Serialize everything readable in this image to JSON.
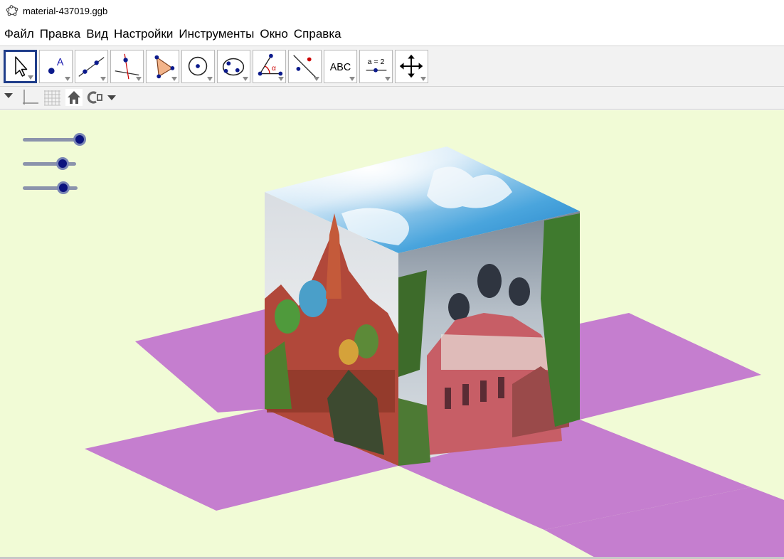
{
  "window": {
    "title": "material-437019.ggb"
  },
  "menu": {
    "items": [
      "Файл",
      "Правка",
      "Вид",
      "Настройки",
      "Инструменты",
      "Окно",
      "Справка"
    ]
  },
  "toolbar": {
    "tools": [
      {
        "name": "move-tool",
        "icon": "arrow-cursor-icon",
        "active": true
      },
      {
        "name": "point-tool",
        "icon": "point-icon",
        "label": "A"
      },
      {
        "name": "line-tool",
        "icon": "line-icon"
      },
      {
        "name": "perpendicular-tool",
        "icon": "perpendicular-line-icon"
      },
      {
        "name": "polygon-tool",
        "icon": "polygon-icon"
      },
      {
        "name": "circle-tool",
        "icon": "circle-icon"
      },
      {
        "name": "conic-tool",
        "icon": "ellipse-icon"
      },
      {
        "name": "angle-tool",
        "icon": "angle-icon",
        "label": "α"
      },
      {
        "name": "reflect-tool",
        "icon": "reflect-icon"
      },
      {
        "name": "text-tool",
        "icon": "text-icon",
        "label": "ABC"
      },
      {
        "name": "slider-tool",
        "icon": "slider-icon",
        "label": "a = 2"
      },
      {
        "name": "move-view-tool",
        "icon": "move-graphics-icon"
      }
    ]
  },
  "stylebar": {
    "icons": [
      "collapse-triangle-icon",
      "axes-icon",
      "grid-icon",
      "home-icon",
      "capture-icon"
    ]
  },
  "sliders": [
    {
      "name": "slider-1",
      "value": 1.0
    },
    {
      "name": "slider-2",
      "value": 0.74
    },
    {
      "name": "slider-3",
      "value": 0.74
    }
  ],
  "colors": {
    "canvas": "#f1fbd6",
    "net": "#c57ecf",
    "accent": "#1f3d8a",
    "knob": "#0b137e"
  }
}
